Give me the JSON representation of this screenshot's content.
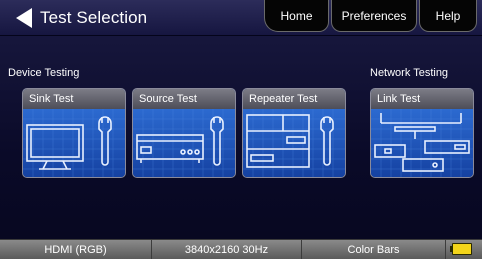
{
  "header": {
    "title": "Test Selection",
    "nav": {
      "home": "Home",
      "preferences": "Preferences",
      "help": "Help"
    }
  },
  "sections": {
    "device_testing": "Device Testing",
    "network_testing": "Network Testing"
  },
  "tiles": {
    "sink": "Sink Test",
    "source": "Source Test",
    "repeater": "Repeater Test",
    "link": "Link Test"
  },
  "status_bar": {
    "color_space": "HDMI (RGB)",
    "resolution": "3840x2160 30Hz",
    "pattern": "Color Bars"
  },
  "icons": {
    "back": "back-arrow-icon",
    "battery": "battery-icon"
  },
  "colors": {
    "tile_blue": "#1a4da0",
    "battery": "#f3d51a"
  }
}
